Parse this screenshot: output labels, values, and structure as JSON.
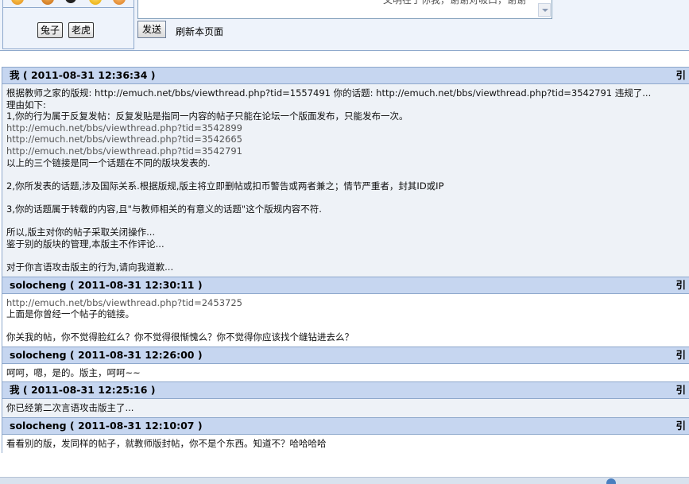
{
  "compose": {
    "tags": [
      "兔子",
      "老虎"
    ],
    "message_placeholder": "文明在于你我，谢谢对吸口，谢谢",
    "send_label": "发送",
    "refresh_label": "刷新本页面"
  },
  "quote_label": "引",
  "posts": [
    {
      "author": "我",
      "time": "2011-08-31 12:36:34",
      "lines": [
        "根据教师之家的版规: http://emuch.net/bbs/viewthread.php?tid=1557491 你的话题: http://emuch.net/bbs/viewthread.php?tid=3542791  违规了...",
        "理由如下:",
        "1,你的行为属于反复发帖：反复发贴是指同一内容的帖子只能在论坛一个版面发布，只能发布一次。",
        "http://emuch.net/bbs/viewthread.php?tid=3542899",
        "http://emuch.net/bbs/viewthread.php?tid=3542665",
        "http://emuch.net/bbs/viewthread.php?tid=3542791",
        "以上的三个链接是同一个话题在不同的版块发表的.",
        "",
        "2,你所发表的话题,涉及国际关系.根据版规,版主将立即删帖或扣币警告或两者兼之；情节严重者，封其ID或IP",
        "",
        "3,你的话题属于转载的内容,且\"与教师相关的有意义的话题\"这个版规内容不符.",
        "",
        "所以,版主对你的帖子采取关闭操作...",
        "鉴于别的版块的管理,本版主不作评论...",
        "",
        "对于你言语攻击版主的行为,请向我道歉..."
      ]
    },
    {
      "author": "solocheng",
      "time": "2011-08-31 12:30:11",
      "lines": [
        "http://emuch.net/bbs/viewthread.php?tid=2453725",
        "上面是你曾经一个帖子的链接。",
        "",
        "你关我的帖，你不觉得脸红么？你不觉得很惭愧么？你不觉得你应该找个缝钻进去么？"
      ]
    },
    {
      "author": "solocheng",
      "time": "2011-08-31 12:26:00",
      "lines": [
        "呵呵，嗯，是的。版主，呵呵~~"
      ]
    },
    {
      "author": "我",
      "time": "2011-08-31 12:25:16",
      "lines": [
        "你已经第二次言语攻击版主了..."
      ]
    },
    {
      "author": "solocheng",
      "time": "2011-08-31 12:10:07",
      "lines": [
        "看看别的版，发同样的帖子，就教师版封帖，你不是个东西。知道不？哈哈哈哈"
      ]
    }
  ]
}
